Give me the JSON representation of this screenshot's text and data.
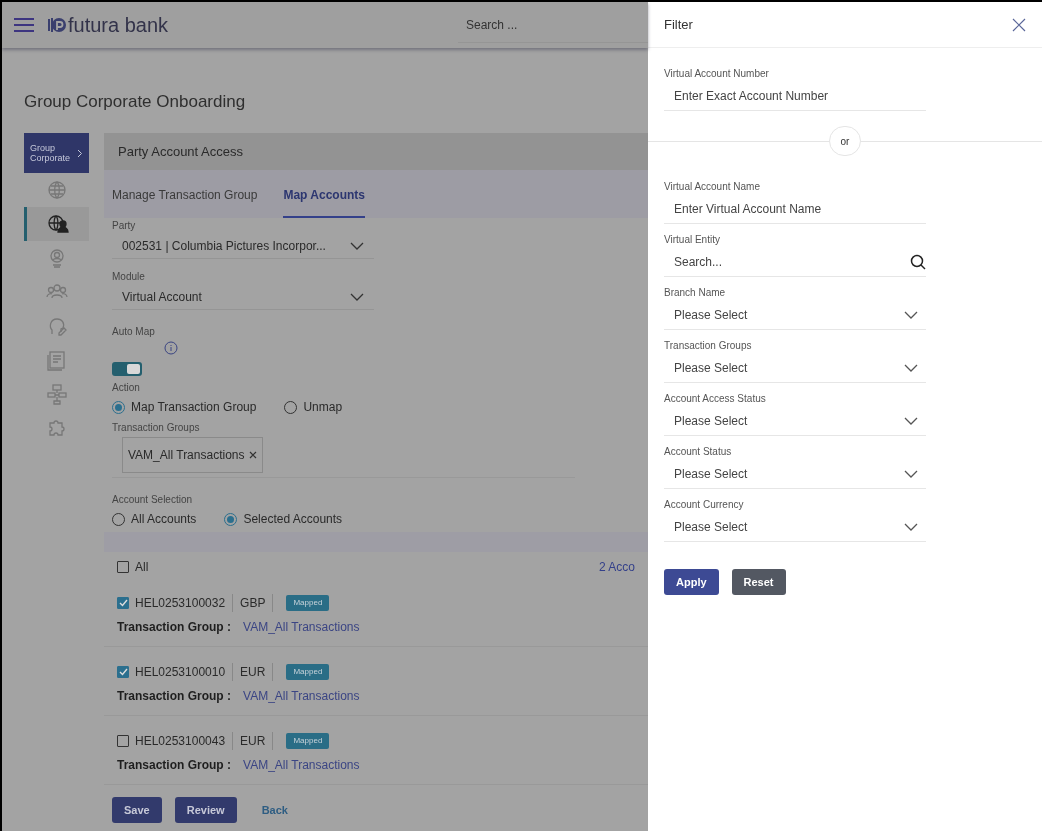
{
  "header": {
    "brand": "futura bank",
    "search_placeholder": "Search ..."
  },
  "page_title": "Group Corporate Onboarding",
  "sidebar": {
    "section_label": "Group Corporate",
    "items": [
      {
        "selected": false
      },
      {
        "selected": true
      },
      {
        "selected": false
      },
      {
        "selected": false
      },
      {
        "selected": false
      },
      {
        "selected": false
      },
      {
        "selected": false
      },
      {
        "selected": false
      }
    ]
  },
  "panel": {
    "title": "Party Account Access",
    "tabs": [
      {
        "label": "Manage Transaction Group",
        "selected": false
      },
      {
        "label": "Map Accounts",
        "selected": true
      }
    ],
    "party": {
      "label": "Party",
      "value": "002531 | Columbia Pictures Incorpor..."
    },
    "module": {
      "label": "Module",
      "value": "Virtual Account"
    },
    "auto_map": {
      "label": "Auto Map",
      "on": true
    },
    "action": {
      "label": "Action",
      "options": [
        {
          "label": "Map Transaction Group",
          "selected": true
        },
        {
          "label": "Unmap",
          "selected": false
        }
      ]
    },
    "transaction_groups": {
      "label": "Transaction Groups",
      "chips": [
        "VAM_All Transactions"
      ]
    },
    "account_selection": {
      "label": "Account Selection",
      "options": [
        {
          "label": "All Accounts",
          "selected": false
        },
        {
          "label": "Selected Accounts",
          "selected": true
        }
      ]
    },
    "accounts_list": {
      "all_label": "All",
      "all_checked": false,
      "count": "2 Acco",
      "accounts": [
        {
          "number": "HEL0253100032",
          "currency": "GBP",
          "status": "Mapped",
          "checked": true,
          "group_label": "Transaction Group :",
          "group": "VAM_All Transactions"
        },
        {
          "number": "HEL0253100010",
          "currency": "EUR",
          "status": "Mapped",
          "checked": true,
          "group_label": "Transaction Group :",
          "group": "VAM_All Transactions"
        },
        {
          "number": "HEL0253100043",
          "currency": "EUR",
          "status": "Mapped",
          "checked": false,
          "group_label": "Transaction Group :",
          "group": "VAM_All Transactions"
        }
      ]
    },
    "buttons": [
      {
        "label": "Save",
        "kind": "primary"
      },
      {
        "label": "Review",
        "kind": "primary"
      },
      {
        "label": "Back",
        "kind": "link"
      }
    ]
  },
  "filter": {
    "title": "Filter",
    "fields": [
      {
        "kind": "text",
        "label": "Virtual Account Number",
        "placeholder": "Enter Exact Account Number"
      },
      {
        "kind": "divider",
        "text": "or"
      },
      {
        "kind": "text",
        "label": "Virtual Account Name",
        "placeholder": "Enter Virtual Account Name"
      },
      {
        "kind": "search",
        "label": "Virtual Entity",
        "placeholder": "Search..."
      },
      {
        "kind": "select",
        "label": "Branch Name",
        "placeholder": "Please Select"
      },
      {
        "kind": "select",
        "label": "Transaction Groups",
        "placeholder": "Please Select"
      },
      {
        "kind": "select",
        "label": "Account Access Status",
        "placeholder": "Please Select"
      },
      {
        "kind": "select",
        "label": "Account Status",
        "placeholder": "Please Select"
      },
      {
        "kind": "select",
        "label": "Account Currency",
        "placeholder": "Please Select"
      }
    ],
    "buttons": [
      {
        "label": "Apply",
        "kind": "primary"
      },
      {
        "label": "Reset",
        "kind": "secondary"
      }
    ]
  }
}
